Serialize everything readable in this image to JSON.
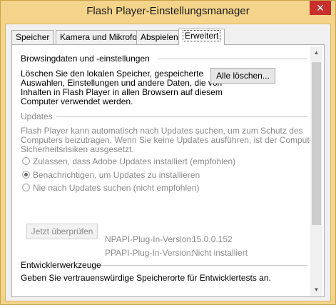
{
  "window": {
    "title": "Flash Player-Einstellungsmanager",
    "close_glyph": "✕"
  },
  "tabs": [
    {
      "label": "Speicher",
      "active": false
    },
    {
      "label": "Kamera und Mikrofon",
      "active": false
    },
    {
      "label": "Abspielen",
      "active": false
    },
    {
      "label": "Erweitert",
      "active": true
    }
  ],
  "browsing": {
    "heading": "Browsingdaten und -einstellungen",
    "lines": [
      "Löschen Sie den lokalen Speicher, gespeicherte",
      "Auswahlen, Einstellungen und andere Daten, die von",
      "Inhalten in Flash Player in allen Browsern auf diesem",
      "Computer verwendet werden."
    ],
    "delete_all_label": "Alle löschen..."
  },
  "updates": {
    "heading": "Updates",
    "lines": [
      "Flash Player kann automatisch nach Updates suchen, um zum Schutz des",
      "Computers beizutragen. Wenn Sie keine Updates ausführen, ist der Computer",
      "Sicherheitsrisiken ausgesetzt."
    ],
    "options": [
      {
        "label": "Zulassen, dass Adobe Updates installiert (empfohlen)",
        "selected": false
      },
      {
        "label": "Benachrichtigen, um Updates zu installieren",
        "selected": true
      },
      {
        "label": "Nie nach Updates suchen (nicht empfohlen)",
        "selected": false
      }
    ],
    "check_now_label": "Jetzt überprüfen",
    "npapi_label": "NPAPI-Plug-In-Version:",
    "npapi_value": "15.0.0.152",
    "ppapi_label": "PPAPI-Plug-In-Version:",
    "ppapi_value": "Nicht installiert"
  },
  "developer": {
    "heading": "Entwicklerwerkzeuge",
    "line": "Geben Sie vertrauenswürdige Speicherorte für Entwicklertests an."
  },
  "icons": {
    "scroll_up": "scroll-up-arrow-icon",
    "scroll_down": "scroll-down-arrow-icon"
  }
}
